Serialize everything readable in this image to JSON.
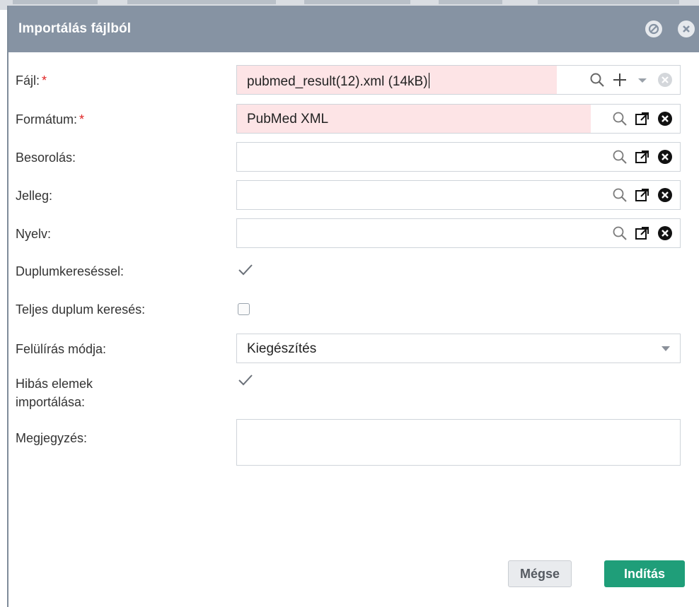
{
  "dialog": {
    "title": "Importálás fájlból"
  },
  "form": {
    "file": {
      "label": "Fájl:",
      "required_mark": "*",
      "value": "pubmed_result(12).xml (14kB)"
    },
    "format": {
      "label": "Formátum:",
      "required_mark": "*",
      "value": "PubMed XML"
    },
    "classification": {
      "label": "Besorolás:",
      "value": ""
    },
    "type": {
      "label": "Jelleg:",
      "value": ""
    },
    "language": {
      "label": "Nyelv:",
      "value": ""
    },
    "duplicate_search": {
      "label": "Duplumkereséssel:",
      "checked": true
    },
    "full_duplicate_search": {
      "label": "Teljes duplum keresés:",
      "checked": false
    },
    "overwrite_mode": {
      "label": "Felülírás módja:",
      "value": "Kiegészítés"
    },
    "import_faulty": {
      "label_line1": "Hibás elemek",
      "label_line2": "importálása:",
      "checked": true
    },
    "note": {
      "label": "Megjegyzés:",
      "value": ""
    }
  },
  "buttons": {
    "cancel": "Mégse",
    "start": "Indítás"
  },
  "colors": {
    "titlebar": "#8693a3",
    "required_fill": "#fde4e6",
    "required_mark": "#e02424",
    "primary": "#1f9e79"
  },
  "icons": [
    "minimize-circle-icon",
    "close-circle-icon",
    "search-icon",
    "plus-icon",
    "dropdown-icon",
    "clear-icon",
    "open-external-icon",
    "remove-icon",
    "checkmark-icon"
  ]
}
